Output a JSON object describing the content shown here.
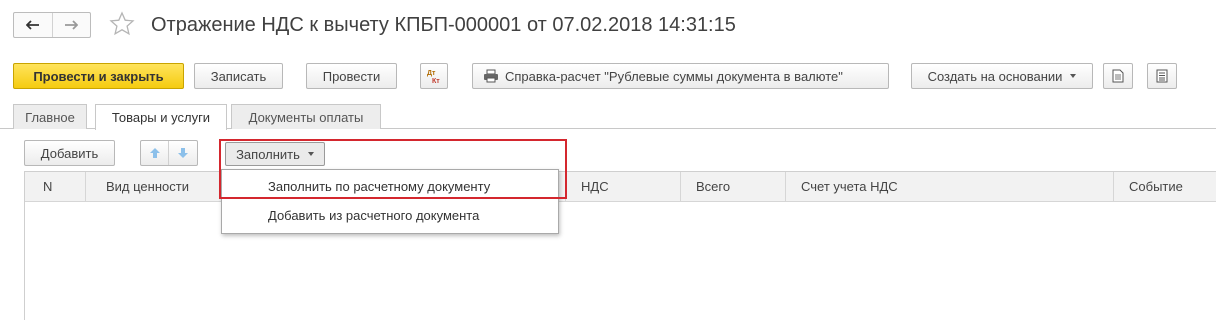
{
  "window": {
    "title": "Отражение НДС к вычету КПБП-000001 от 07.02.2018 14:31:15"
  },
  "toolbar": {
    "post_and_close": "Провести и закрыть",
    "save": "Записать",
    "post": "Провести",
    "print_report": "Справка-расчет \"Рублевые суммы документа в валюте\"",
    "create_based_on": "Создать на основании"
  },
  "tabs": [
    {
      "label": "Главное",
      "active": false
    },
    {
      "label": "Товары и услуги",
      "active": true
    },
    {
      "label": "Документы оплаты",
      "active": false
    }
  ],
  "subtoolbar": {
    "add": "Добавить",
    "fill": "Заполнить"
  },
  "table": {
    "columns": [
      "N",
      "Вид ценности",
      "НДС",
      "Всего",
      "Счет учета НДС",
      "Событие"
    ]
  },
  "dropdown": {
    "items": [
      "Заполнить по расчетному документу",
      "Добавить из расчетного документа"
    ]
  },
  "colors": {
    "primary_button": "#f5cc10",
    "highlight_frame": "#d4272e"
  }
}
